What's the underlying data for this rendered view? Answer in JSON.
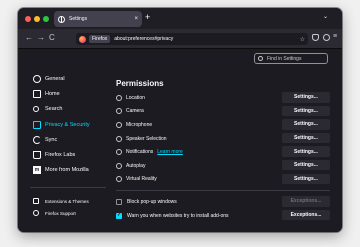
{
  "tab": {
    "title": "Settings",
    "close": "×",
    "new_tab": "+",
    "list": "⌄"
  },
  "nav": {
    "back": "←",
    "forward": "→",
    "reload": "C",
    "identity": "Firefox",
    "url": "about:preferences#privacy",
    "star": "☆",
    "menu": "≡"
  },
  "search": {
    "placeholder": "Find in Settings"
  },
  "sidebar": {
    "items": [
      {
        "label": "General",
        "icon": "gear-icon"
      },
      {
        "label": "Home",
        "icon": "home-icon"
      },
      {
        "label": "Search",
        "icon": "search-icon"
      },
      {
        "label": "Privacy & Security",
        "icon": "lock-icon",
        "active": true
      },
      {
        "label": "Sync",
        "icon": "sync-icon"
      },
      {
        "label": "Firefox Labs",
        "icon": "flask-icon"
      },
      {
        "label": "More from Mozilla",
        "icon": "mozilla-icon",
        "glyph": "m"
      }
    ],
    "bottom": [
      {
        "label": "Extensions & Themes",
        "icon": "puzzle-icon"
      },
      {
        "label": "Firefox Support",
        "icon": "help-icon"
      }
    ]
  },
  "permissions": {
    "title": "Permissions",
    "settings_label": "Settings...",
    "rows": [
      {
        "label": "Location",
        "icon": "location-icon"
      },
      {
        "label": "Camera",
        "icon": "camera-icon"
      },
      {
        "label": "Microphone",
        "icon": "microphone-icon"
      },
      {
        "label": "Speaker Selection",
        "icon": "speaker-icon"
      },
      {
        "label": "Notifications",
        "icon": "notification-icon",
        "link": "Learn more"
      },
      {
        "label": "Autoplay",
        "icon": "autoplay-icon"
      },
      {
        "label": "Virtual Reality",
        "icon": "vr-icon"
      }
    ],
    "checks": [
      {
        "label": "Block pop-up windows",
        "checked": false,
        "button": "Exceptions...",
        "disabled": true
      },
      {
        "label": "Warn you when websites try to install add-ons",
        "checked": true,
        "button": "Exceptions...",
        "disabled": false
      }
    ]
  },
  "colors": {
    "accent": "#00ddff",
    "background": "#1c1b22",
    "button": "#2b2a33"
  }
}
